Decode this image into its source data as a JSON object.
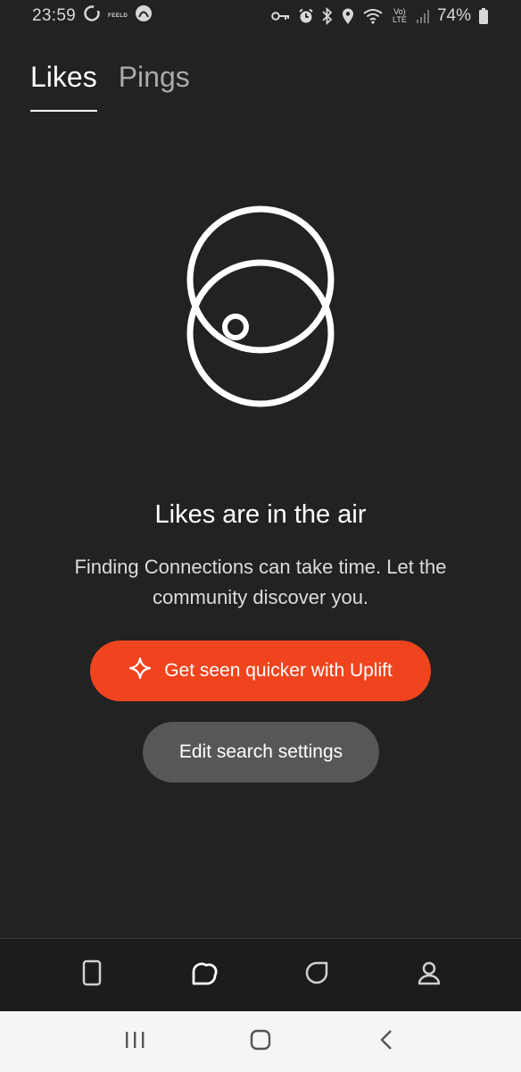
{
  "status_bar": {
    "time": "23:59",
    "app_label": "FEELD",
    "battery": "74%",
    "network": "Vo) LTE"
  },
  "tabs": [
    {
      "label": "Likes",
      "active": true
    },
    {
      "label": "Pings",
      "active": false
    }
  ],
  "empty_state": {
    "title": "Likes are in the air",
    "description": "Finding Connections can take time. Let the community discover you."
  },
  "buttons": {
    "uplift_label": "Get seen quicker with Uplift",
    "edit_label": "Edit search settings"
  },
  "bottom_nav": {
    "items": [
      "discover-icon",
      "likes-icon",
      "chats-icon",
      "profile-icon"
    ],
    "active": "likes-icon"
  },
  "system_nav": {
    "items": [
      "recents-icon",
      "home-icon",
      "back-icon"
    ]
  },
  "colors": {
    "background": "#222222",
    "accent": "#f0441e",
    "secondary_button": "#575757",
    "inactive_text": "#a9a9a9"
  }
}
